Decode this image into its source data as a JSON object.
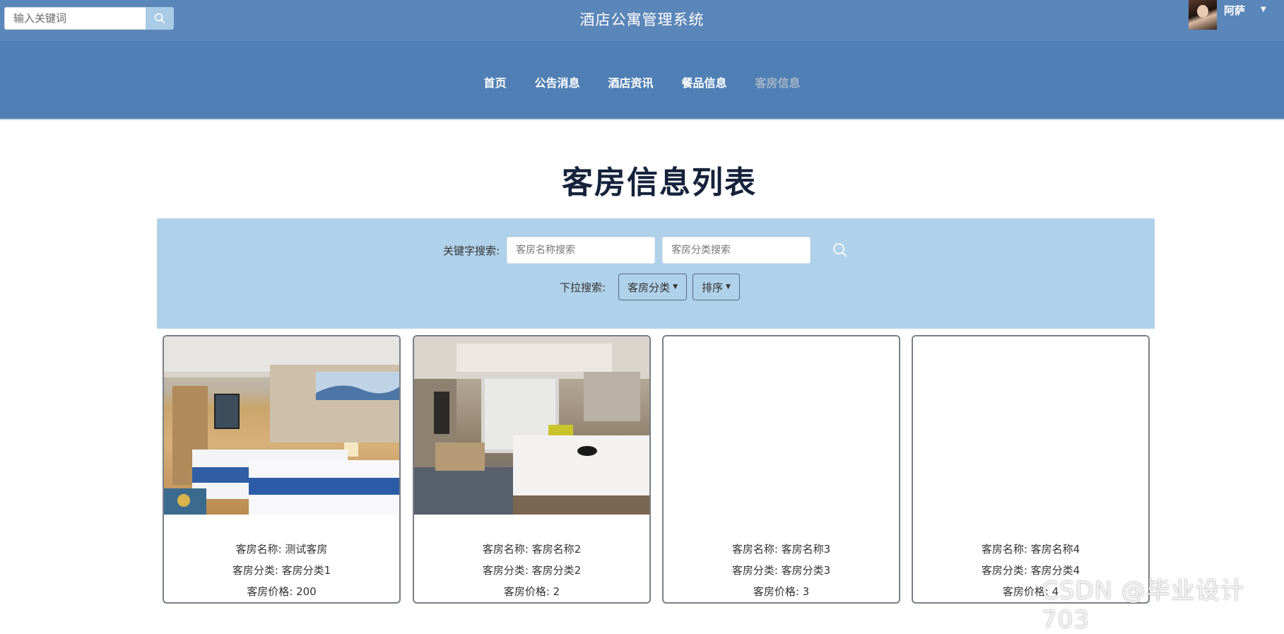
{
  "header": {
    "search_placeholder": "输入关键词",
    "site_title": "酒店公寓管理系统",
    "user_name": "阿萨"
  },
  "nav": {
    "items": [
      {
        "label": "首页",
        "active": false
      },
      {
        "label": "公告消息",
        "active": false
      },
      {
        "label": "酒店资讯",
        "active": false
      },
      {
        "label": "餐品信息",
        "active": false
      },
      {
        "label": "客房信息",
        "active": true
      }
    ]
  },
  "page": {
    "title": "客房信息列表"
  },
  "filter": {
    "keyword_label": "关键字搜索:",
    "name_placeholder": "客房名称搜索",
    "category_placeholder": "客房分类搜索",
    "dropdown_label": "下拉搜索:",
    "category_dropdown": "客房分类",
    "sort_dropdown": "排序"
  },
  "rooms": [
    {
      "name": "客房名称: 测试客房",
      "category": "客房分类: 客房分类1",
      "price": "客房价格: 200"
    },
    {
      "name": "客房名称: 客房名称2",
      "category": "客房分类: 客房分类2",
      "price": "客房价格: 2"
    },
    {
      "name": "客房名称: 客房名称3",
      "category": "客房分类: 客房分类3",
      "price": "客房价格: 3"
    },
    {
      "name": "客房名称: 客房名称4",
      "category": "客房分类: 客房分类4",
      "price": "客房价格: 4"
    }
  ],
  "watermark": "CSDN @毕业设计703",
  "colors": {
    "topbar": "#5b86b9",
    "navbar": "#4f7fb4",
    "filter_panel": "#afd1ea",
    "nav_active": "#a5b4c7",
    "title": "#15223a"
  }
}
